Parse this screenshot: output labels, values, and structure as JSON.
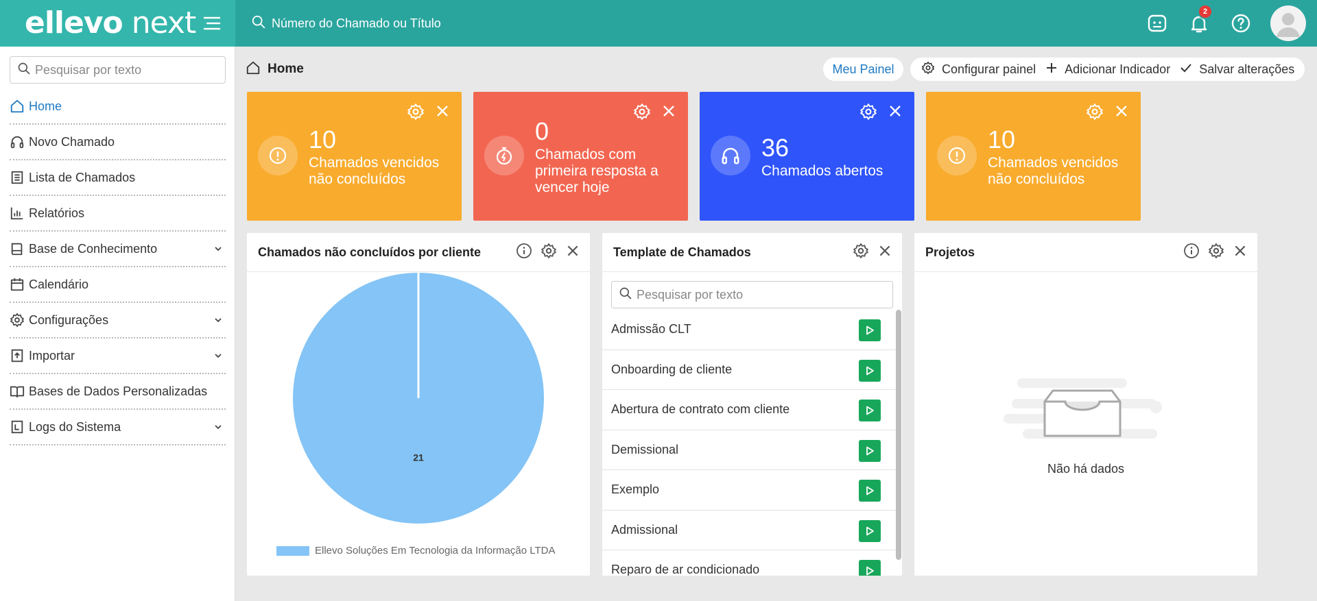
{
  "app": {
    "logo_bold": "ellevo",
    "logo_light": " next"
  },
  "topbar": {
    "search_placeholder": "Número do Chamado ou Título",
    "notification_count": "2"
  },
  "sidebar": {
    "search_placeholder": "Pesquisar por texto",
    "items": [
      {
        "label": "Home",
        "icon": "home-icon",
        "active": true,
        "expandable": false
      },
      {
        "label": "Novo Chamado",
        "icon": "headset-icon",
        "expandable": false
      },
      {
        "label": "Lista de Chamados",
        "icon": "document-icon",
        "expandable": false
      },
      {
        "label": "Relatórios",
        "icon": "report-chart-icon",
        "expandable": false
      },
      {
        "label": "Base de Conhecimento",
        "icon": "book-icon",
        "expandable": true
      },
      {
        "label": "Calendário",
        "icon": "calendar-icon",
        "expandable": false
      },
      {
        "label": "Configurações",
        "icon": "gear-icon",
        "expandable": true
      },
      {
        "label": "Importar",
        "icon": "upload-file-icon",
        "expandable": true
      },
      {
        "label": "Bases de Dados Personalizadas",
        "icon": "open-book-icon",
        "expandable": false
      },
      {
        "label": "Logs do Sistema",
        "icon": "log-file-icon",
        "expandable": true
      }
    ]
  },
  "main": {
    "breadcrumb": "Home",
    "meu_painel": "Meu Painel",
    "actions": {
      "configure": "Configurar painel",
      "add_indicator": "Adicionar Indicador",
      "save": "Salvar alterações"
    }
  },
  "cards": [
    {
      "value": "10",
      "text": "Chamados vencidos não concluídos",
      "color": "#f9ab2d",
      "icon": "alert-circle-icon"
    },
    {
      "value": "0",
      "text": "Chamados com primeira resposta a vencer hoje",
      "color": "#f26651",
      "icon": "stopwatch-icon"
    },
    {
      "value": "36",
      "text": "Chamados abertos",
      "color": "#2f54fa",
      "icon": "headset-icon"
    },
    {
      "value": "10",
      "text": "Chamados vencidos não concluídos",
      "color": "#f9ab2d",
      "icon": "alert-circle-icon"
    }
  ],
  "widgets": {
    "pie": {
      "title": "Chamados não concluídos por cliente"
    },
    "templates": {
      "title": "Template de Chamados",
      "search_placeholder": "Pesquisar por texto",
      "items": [
        "Admissão CLT",
        "Onboarding de cliente",
        "Abertura de contrato com cliente",
        "Demissional",
        "Exemplo",
        "Admissional",
        "Reparo de ar condicionado"
      ]
    },
    "projects": {
      "title": "Projetos",
      "empty_text": "Não há dados"
    }
  },
  "chart_data": {
    "type": "pie",
    "title": "Chamados não concluídos por cliente",
    "slices": [
      {
        "label": "Ellevo Soluções Em Tecnologia da Informação LTDA",
        "value": 21,
        "color": "#84c4f6"
      }
    ],
    "legend_position": "bottom"
  }
}
